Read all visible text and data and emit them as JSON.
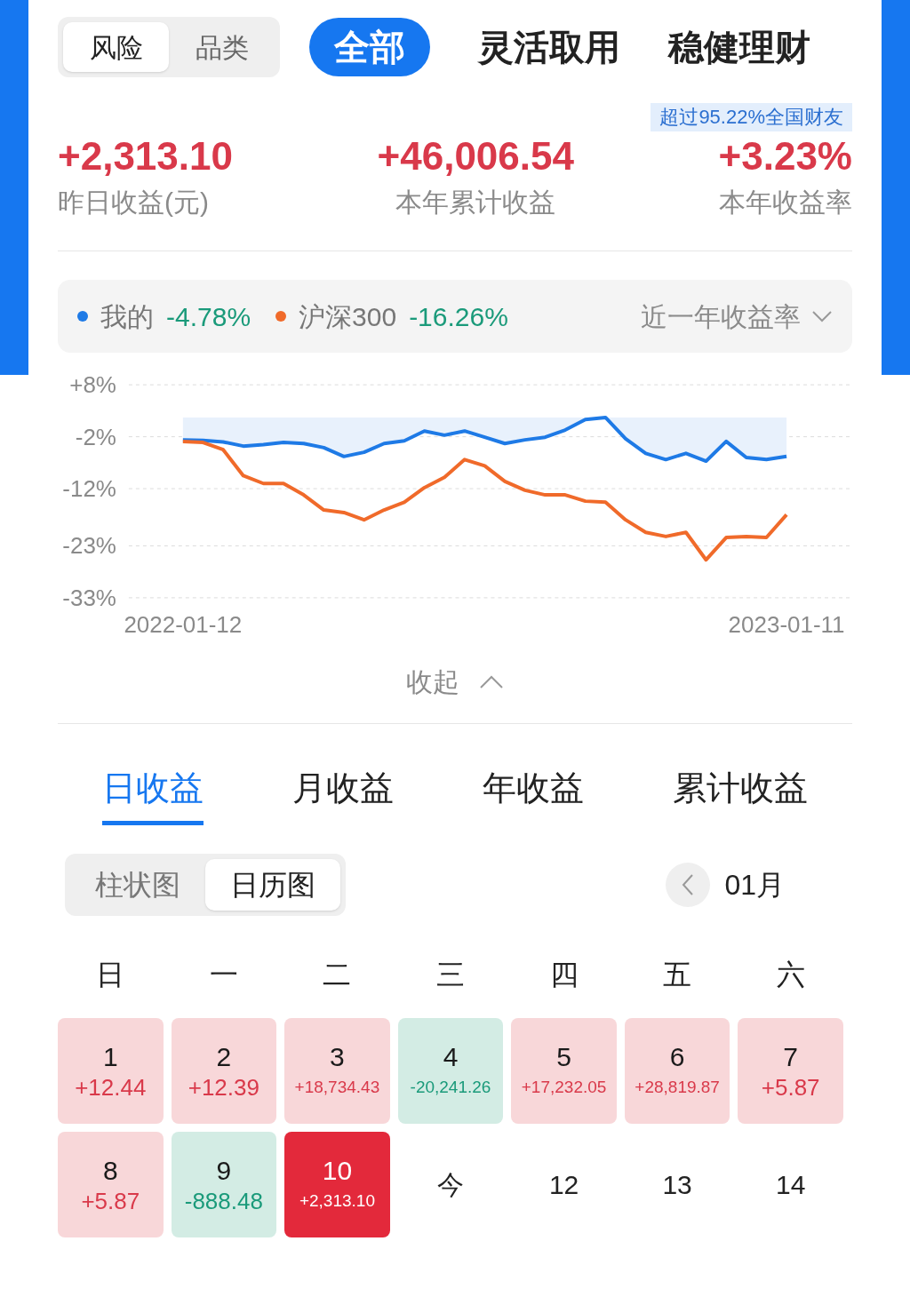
{
  "segment": [
    {
      "label": "风险",
      "selected": true
    },
    {
      "label": "品类",
      "selected": false
    }
  ],
  "top_tabs": [
    {
      "label": "全部",
      "selected": true
    },
    {
      "label": "灵活取用",
      "selected": false
    },
    {
      "label": "稳健理财",
      "selected": false
    }
  ],
  "rank_badge": "超过95.22%全国财友",
  "stats": [
    {
      "value": "+2,313.10",
      "label": "昨日收益(元)"
    },
    {
      "value": "+46,006.54",
      "label": "本年累计收益"
    },
    {
      "value": "+3.23%",
      "label": "本年收益率"
    }
  ],
  "legend": [
    {
      "value": "-4.78%"
    },
    {
      "value": "-16.26%"
    }
  ],
  "period_select": "近一年收益率",
  "chart_data": {
    "type": "line",
    "ylim": [
      -33,
      8
    ],
    "yticks": [
      {
        "value": 8,
        "label": "+8%"
      },
      {
        "value": -2,
        "label": "-2%"
      },
      {
        "value": -12,
        "label": "-12%"
      },
      {
        "value": -23,
        "label": "-23%"
      },
      {
        "value": -33,
        "label": "-33%"
      }
    ],
    "categories": [
      "2022-01-12",
      null,
      null,
      null,
      null,
      null,
      null,
      null,
      null,
      null,
      null,
      null,
      null,
      null,
      null,
      null,
      null,
      null,
      null,
      null,
      null,
      null,
      null,
      null,
      null,
      null,
      null,
      null,
      null,
      null,
      "2023-01-11"
    ],
    "grid": true,
    "series": [
      {
        "name": "我的",
        "color": "#1e7ae6",
        "values": [
          -2.6,
          -2.7,
          -3.0,
          -3.8,
          -3.5,
          -3.1,
          -3.3,
          -4.1,
          -5.8,
          -5.0,
          -3.3,
          -2.8,
          -0.9,
          -1.7,
          -0.9,
          -2.1,
          -3.3,
          -2.6,
          -2.1,
          -0.7,
          1.3,
          1.7,
          -2.4,
          -5.2,
          -6.4,
          -5.2,
          -6.7,
          -2.9,
          -6.0,
          -6.4,
          -5.8
        ]
      },
      {
        "name": "沪深300",
        "color": "#f06a2a",
        "values": [
          -2.9,
          -3.1,
          -4.5,
          -9.5,
          -11.0,
          -11.0,
          -13.2,
          -16.1,
          -16.6,
          -18.0,
          -16.1,
          -14.6,
          -11.8,
          -9.8,
          -6.4,
          -7.6,
          -10.6,
          -12.3,
          -13.2,
          -13.2,
          -14.4,
          -14.6,
          -18.0,
          -20.4,
          -21.2,
          -20.4,
          -25.7,
          -21.4,
          -21.2,
          -21.4,
          -17.0
        ]
      }
    ]
  },
  "collapse": "收起",
  "period_tabs": [
    {
      "label": "日收益",
      "selected": true
    },
    {
      "label": "月收益",
      "selected": false
    },
    {
      "label": "年收益",
      "selected": false
    },
    {
      "label": "累计收益",
      "selected": false
    }
  ],
  "view_toggle": [
    {
      "label": "柱状图",
      "selected": false
    },
    {
      "label": "日历图",
      "selected": true
    }
  ],
  "month": "01月",
  "weekdays": [
    "日",
    "一",
    "二",
    "三",
    "四",
    "五",
    "六"
  ],
  "days": [
    {
      "day": "1",
      "amount": "+12.44",
      "kind": "gain"
    },
    {
      "day": "2",
      "amount": "+12.39",
      "kind": "gain"
    },
    {
      "day": "3",
      "amount": "+18,734.43",
      "kind": "gain"
    },
    {
      "day": "4",
      "amount": "-20,241.26",
      "kind": "loss"
    },
    {
      "day": "5",
      "amount": "+17,232.05",
      "kind": "gain"
    },
    {
      "day": "6",
      "amount": "+28,819.87",
      "kind": "gain"
    },
    {
      "day": "7",
      "amount": "+5.87",
      "kind": "gain"
    },
    {
      "day": "8",
      "amount": "+5.87",
      "kind": "gain"
    },
    {
      "day": "9",
      "amount": "-888.48",
      "kind": "loss"
    },
    {
      "day": "10",
      "amount": "+2,313.10",
      "kind": "selected"
    },
    {
      "day": "今",
      "kind": "future"
    },
    {
      "day": "12",
      "kind": "future"
    },
    {
      "day": "13",
      "kind": "future"
    },
    {
      "day": "14",
      "kind": "future"
    }
  ]
}
